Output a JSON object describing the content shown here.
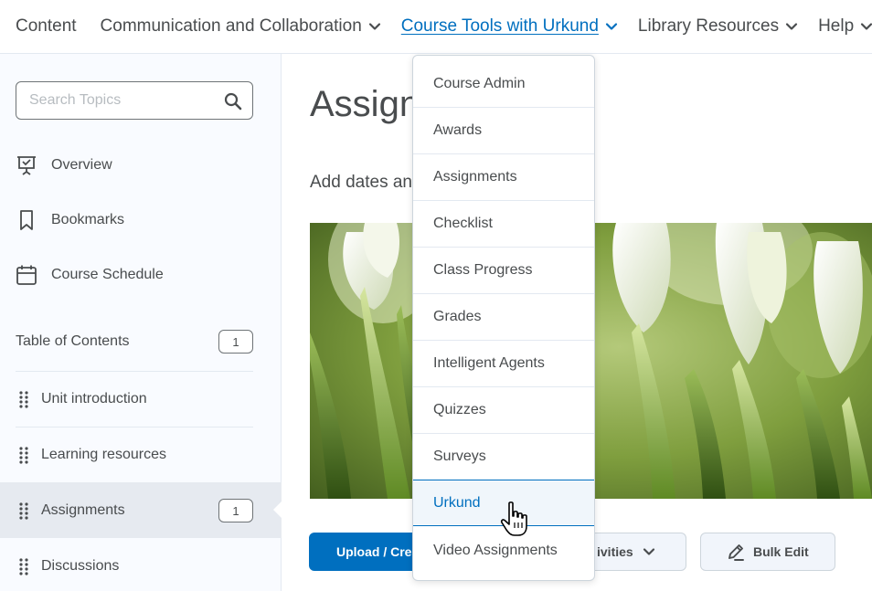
{
  "nav": {
    "items": [
      {
        "label": "Content"
      },
      {
        "label": "Communication and Collaboration"
      },
      {
        "label": "Course Tools with Urkund"
      },
      {
        "label": "Library Resources"
      },
      {
        "label": "Help"
      }
    ]
  },
  "sidebar": {
    "search_placeholder": "Search Topics",
    "links": [
      {
        "label": "Overview",
        "icon": "presentation-icon"
      },
      {
        "label": "Bookmarks",
        "icon": "bookmark-icon"
      },
      {
        "label": "Course Schedule",
        "icon": "calendar-icon"
      }
    ],
    "toc": {
      "label": "Table of Contents",
      "count": "1",
      "items": [
        {
          "label": "Unit introduction"
        },
        {
          "label": "Learning resources"
        },
        {
          "label": "Assignments",
          "count": "1"
        },
        {
          "label": "Discussions"
        }
      ]
    }
  },
  "main": {
    "title": "Assign",
    "subtitle": "Add dates and",
    "upload_label": "Upload / Crea",
    "activities_label": "ivities",
    "bulk_edit_label": "Bulk Edit"
  },
  "dropdown": {
    "items": [
      "Course Admin",
      "Awards",
      "Assignments",
      "Checklist",
      "Class Progress",
      "Grades",
      "Intelligent Agents",
      "Quizzes",
      "Surveys",
      "Urkund",
      "Video Assignments"
    ],
    "hovered": "Urkund"
  },
  "colors": {
    "accent": "#006fbf",
    "text": "#494c4e",
    "sidebar_bg": "#f9fbff"
  }
}
